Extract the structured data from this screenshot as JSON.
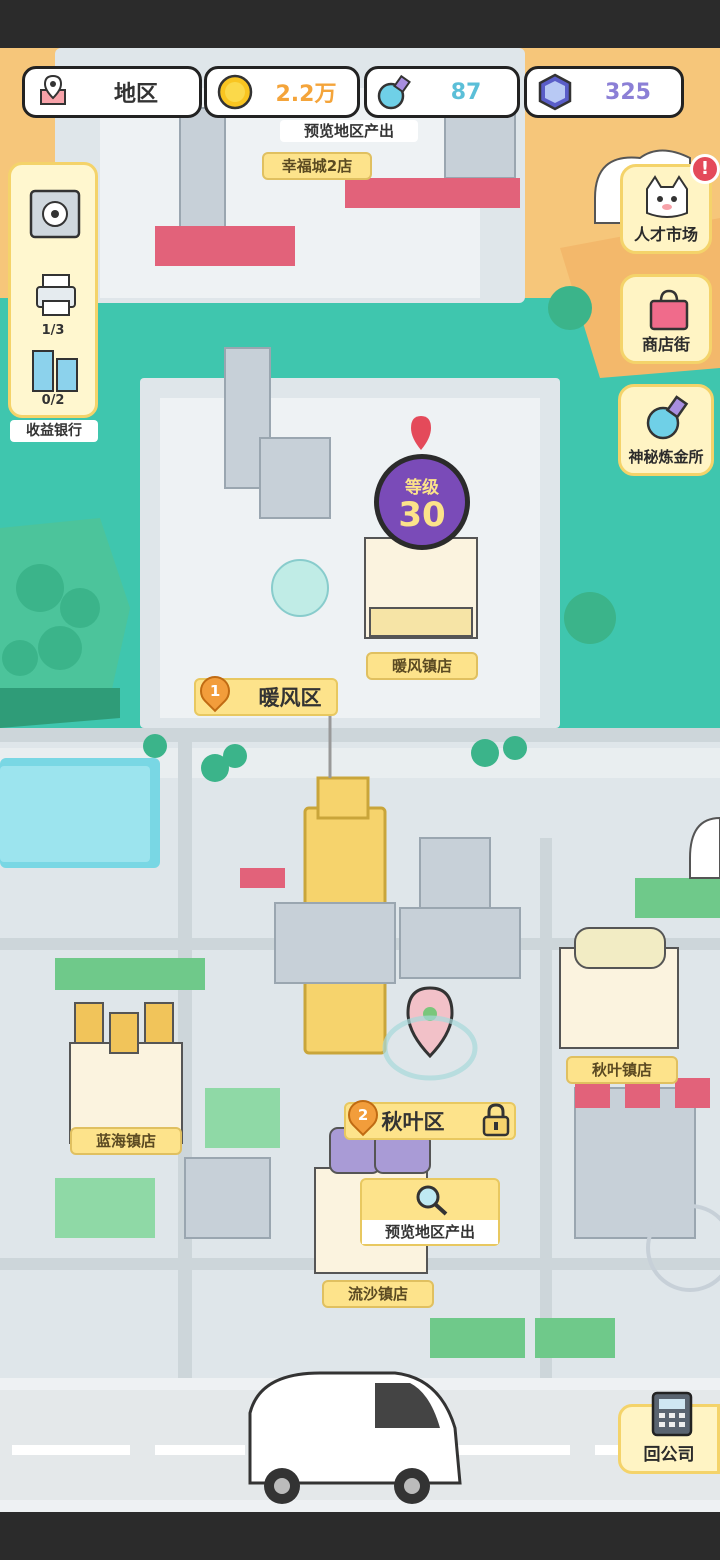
{
  "top_bar": {
    "region_label": "地区",
    "coins": "2.2万",
    "potions": "87",
    "gems": "325",
    "preview_label": "预览地区产出"
  },
  "left_panel": {
    "printer_count": "1/3",
    "building_count": "0/2",
    "bank_label": "收益银行"
  },
  "right_menu": {
    "talent_market": "人才市场",
    "shop_street": "商店街",
    "alchemy": "神秘炼金所"
  },
  "level_badge": {
    "label": "等级",
    "value": "30"
  },
  "stores": {
    "xingfu": "幸福城2店",
    "nuanfeng": "暖风镇店",
    "lanhai": "蓝海镇店",
    "qiuye": "秋叶镇店",
    "liusha": "流沙镇店"
  },
  "districts": {
    "d1_num": "1",
    "d1_name": "暖风区",
    "d2_num": "2",
    "d2_name": "秋叶区"
  },
  "preview_button": {
    "label": "预览地区产出"
  },
  "return_button": {
    "label": "回公司"
  },
  "colors": {
    "water": "#3fc6ae",
    "ground": "#e9eef0",
    "road": "#d5dde0",
    "tag_yellow": "#fde38b",
    "coin_orange": "#f4a43a",
    "potion_blue": "#5bbfd8",
    "gem_purple": "#8b7fd6"
  }
}
